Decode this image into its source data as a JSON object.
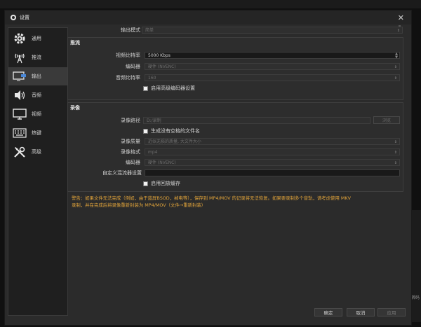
{
  "window": {
    "title": "设置",
    "close": "✕"
  },
  "sidebar": {
    "items": [
      {
        "label": "通用",
        "icon": "gear-icon"
      },
      {
        "label": "推流",
        "icon": "antenna-icon"
      },
      {
        "label": "输出",
        "icon": "monitor-output-icon",
        "active": true
      },
      {
        "label": "音频",
        "icon": "speaker-icon"
      },
      {
        "label": "视频",
        "icon": "display-icon"
      },
      {
        "label": "热键",
        "icon": "keyboard-icon"
      },
      {
        "label": "高级",
        "icon": "tools-icon"
      }
    ]
  },
  "output_mode": {
    "label": "输出模式",
    "value": "简单"
  },
  "streaming": {
    "title": "推流",
    "video_bitrate_label": "视频比特率",
    "video_bitrate_value": "5000 Kbps",
    "encoder_label": "编码器",
    "encoder_value": "硬件 (NVENC)",
    "audio_bitrate_label": "音频比特率",
    "audio_bitrate_value": "160",
    "advanced_checkbox": "启用高级编码器设置"
  },
  "recording": {
    "title": "录像",
    "path_label": "录像路径",
    "path_value": "D:/录制",
    "browse_button": "浏览",
    "no_space_checkbox": "生成没有空格的文件名",
    "quality_label": "录像质量",
    "quality_value": "近似无损的质量, 大文件大小",
    "format_label": "录像格式",
    "format_value": "mp4",
    "encoder_label": "编码器",
    "encoder_value": "硬件 (NVENC)",
    "muxer_label": "自定义混流器设置",
    "muxer_value": "",
    "replay_checkbox": "启用回放缓存"
  },
  "warning": {
    "line1": "警告：如果文件无法完成（例如，由于蓝屏BSOD，掉电等），保存到 MP4/MOV 的记录将无法恢复。如果要录制多个音轨，请考虑使用 MKV",
    "line2": "录制，并在完成后将录像重新封装为 MP4/MOV（文件→重新封装）"
  },
  "footer": {
    "ok": "确定",
    "cancel": "取消",
    "apply": "应用"
  },
  "edge": {
    "label": "转码"
  },
  "colors": {
    "warning": "#e0a33a",
    "background": "#2b2b2b",
    "field": "#191919"
  }
}
